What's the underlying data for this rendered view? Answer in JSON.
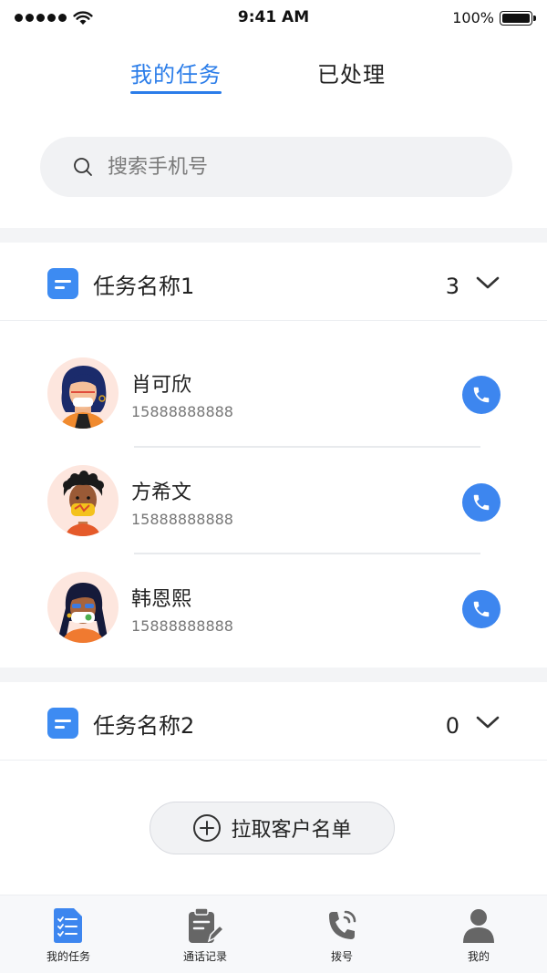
{
  "status_bar": {
    "time": "9:41 AM",
    "battery": "100%"
  },
  "tabs": [
    {
      "label": "我的任务"
    },
    {
      "label": "已处理"
    }
  ],
  "search": {
    "placeholder": "搜索手机号"
  },
  "groups": [
    {
      "title": "任务名称1",
      "count": "3",
      "contacts": [
        {
          "name": "肖可欣",
          "phone": "15888888888"
        },
        {
          "name": "方希文",
          "phone": "15888888888"
        },
        {
          "name": "韩恩熙",
          "phone": "15888888888"
        }
      ]
    },
    {
      "title": "任务名称2",
      "count": "0",
      "contacts": []
    }
  ],
  "pull_button": {
    "label": "拉取客户名单"
  },
  "bottom_nav": [
    {
      "label": "我的任务",
      "icon": "task-list-icon"
    },
    {
      "label": "通话记录",
      "icon": "call-record-icon"
    },
    {
      "label": "拨号",
      "icon": "dial-icon"
    },
    {
      "label": "我的",
      "icon": "user-icon"
    }
  ],
  "colors": {
    "accent": "#2b7de9",
    "call_button": "#3d86ef",
    "group_icon": "#3d8bf2"
  }
}
